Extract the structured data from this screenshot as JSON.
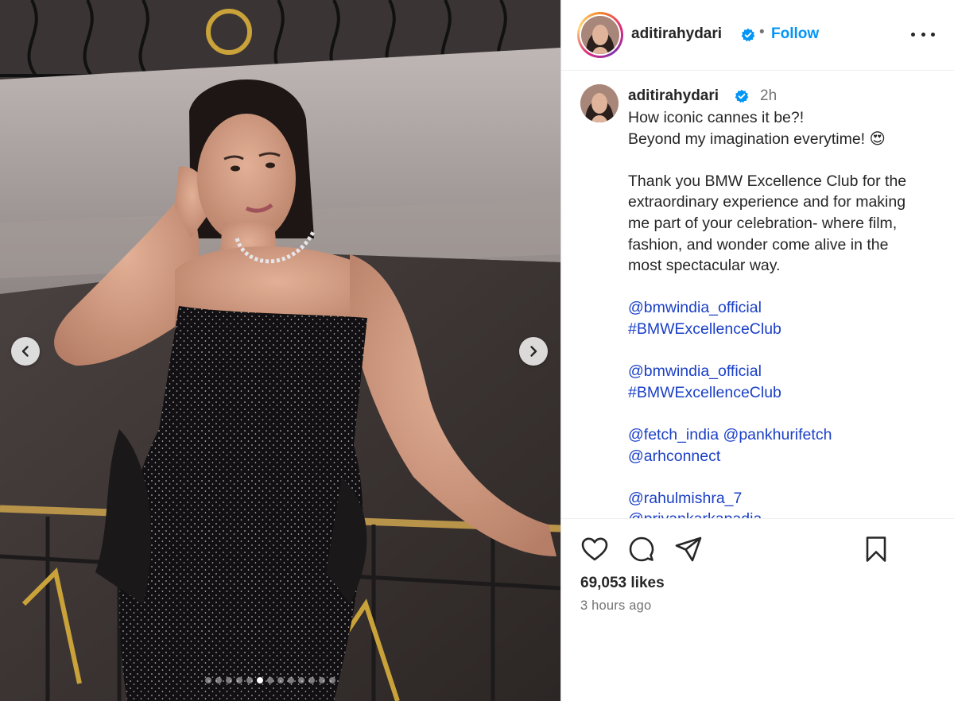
{
  "post": {
    "username": "aditirahydari",
    "follow_label": "Follow",
    "separator": "•",
    "time_short": "2h",
    "likes": "69,053 likes",
    "time_long": "3 hours ago",
    "caption_lines": [
      "How iconic cannes it be?!",
      "Beyond my imagination everytime! 😍",
      "",
      "Thank you BMW Excellence Club for the",
      "extraordinary experience and for making",
      "me part of your celebration- where film,",
      "fashion, and wonder come alive in the",
      "most spectacular way.",
      "",
      "@bmwindia_official",
      "#BMWExcellenceClub",
      "",
      "@bmwindia_official",
      "#BMWExcellenceClub",
      "",
      "@fetch_india @pankhurifetch",
      "@arhconnect",
      "",
      "@rahulmishra_7",
      "@priyankarkapadia"
    ]
  },
  "carousel": {
    "total": 13,
    "active_index": 5
  },
  "colors": {
    "link": "#1a3fc7",
    "follow": "#0095f6",
    "verified": "#0095f6"
  },
  "icons": [
    "chevron-left-icon",
    "chevron-right-icon",
    "more-icon",
    "verified-icon",
    "heart-icon",
    "comment-icon",
    "share-icon",
    "bookmark-icon"
  ]
}
